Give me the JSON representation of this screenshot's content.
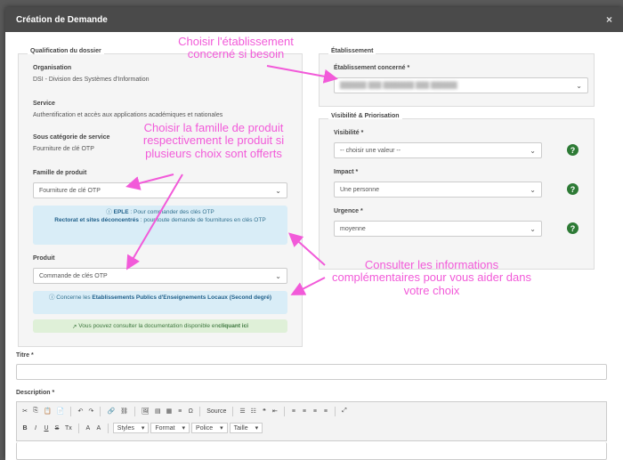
{
  "modal": {
    "title": "Création de Demande",
    "close": "×"
  },
  "qualification": {
    "legend": "Qualification du dossier",
    "organisation_label": "Organisation",
    "organisation_value": "DSI - Division des Systèmes d'Information",
    "service_label": "Service",
    "service_value": "Authentification et accès aux applications académiques et nationales",
    "sous_cat_label": "Sous catégorie de service",
    "sous_cat_value": "Fourniture de clé OTP",
    "famille_label": "Famille de produit",
    "famille_value": "Fourniture de clé OTP",
    "info1_bold": "EPLE",
    "info1_text": " : Pour commander des clés OTP",
    "info1_bold2": "Rectorat et sites déconcentrés",
    "info1_text2": " : pour toute demande de fournitures en clés OTP",
    "produit_label": "Produit",
    "produit_value": "Commande de clés OTP",
    "info2_text": "Concerne les ",
    "info2_bold": "Etablissements Publics d'Enseignements Locaux (Second degré)",
    "doc_text": "Vous pouvez consulter la documentation disponible en ",
    "doc_link": "cliquant ici"
  },
  "etablissement": {
    "legend": "Établissement",
    "label": "Établissement concerné *",
    "value": "██████ ███ ███████ ███ ██████"
  },
  "priorisation": {
    "legend": "Visibilité & Priorisation",
    "visibilite_label": "Visibilité *",
    "visibilite_value": "-- choisir une valeur --",
    "impact_label": "Impact *",
    "impact_value": "Une personne",
    "urgence_label": "Urgence *",
    "urgence_value": "moyenne",
    "help": "?"
  },
  "titre_label": "Titre *",
  "description_label": "Description *",
  "toolbar": {
    "row1": [
      "✂",
      "⎘",
      "📋",
      "📄",
      "↶",
      "↷",
      "🔗",
      "⛓",
      "🖼",
      "▤",
      "▦",
      "≡",
      "Ω",
      "Source",
      "☰",
      "☷",
      "❝",
      "⇤",
      "≡",
      "≡",
      "≡",
      "≡",
      "⤢"
    ],
    "row2": [
      "B",
      "I",
      "U",
      "S",
      "Tx",
      "A",
      "A"
    ],
    "styles": "Styles",
    "format": "Format",
    "police": "Police",
    "taille": "Taille"
  },
  "annotations": {
    "a1": "Choisir l'établissement concerné si besoin",
    "a2": "Choisir la famille de produit respectivement le produit si plusieurs choix sont offerts",
    "a3": "Consulter les informations complémentaires pour vous aider dans votre choix"
  },
  "colors": {
    "annotation": "#f25ad9",
    "header": "#4a4a4a",
    "info_bg": "#d9edf7",
    "success_bg": "#dff0d8",
    "help": "#2d7a35"
  }
}
